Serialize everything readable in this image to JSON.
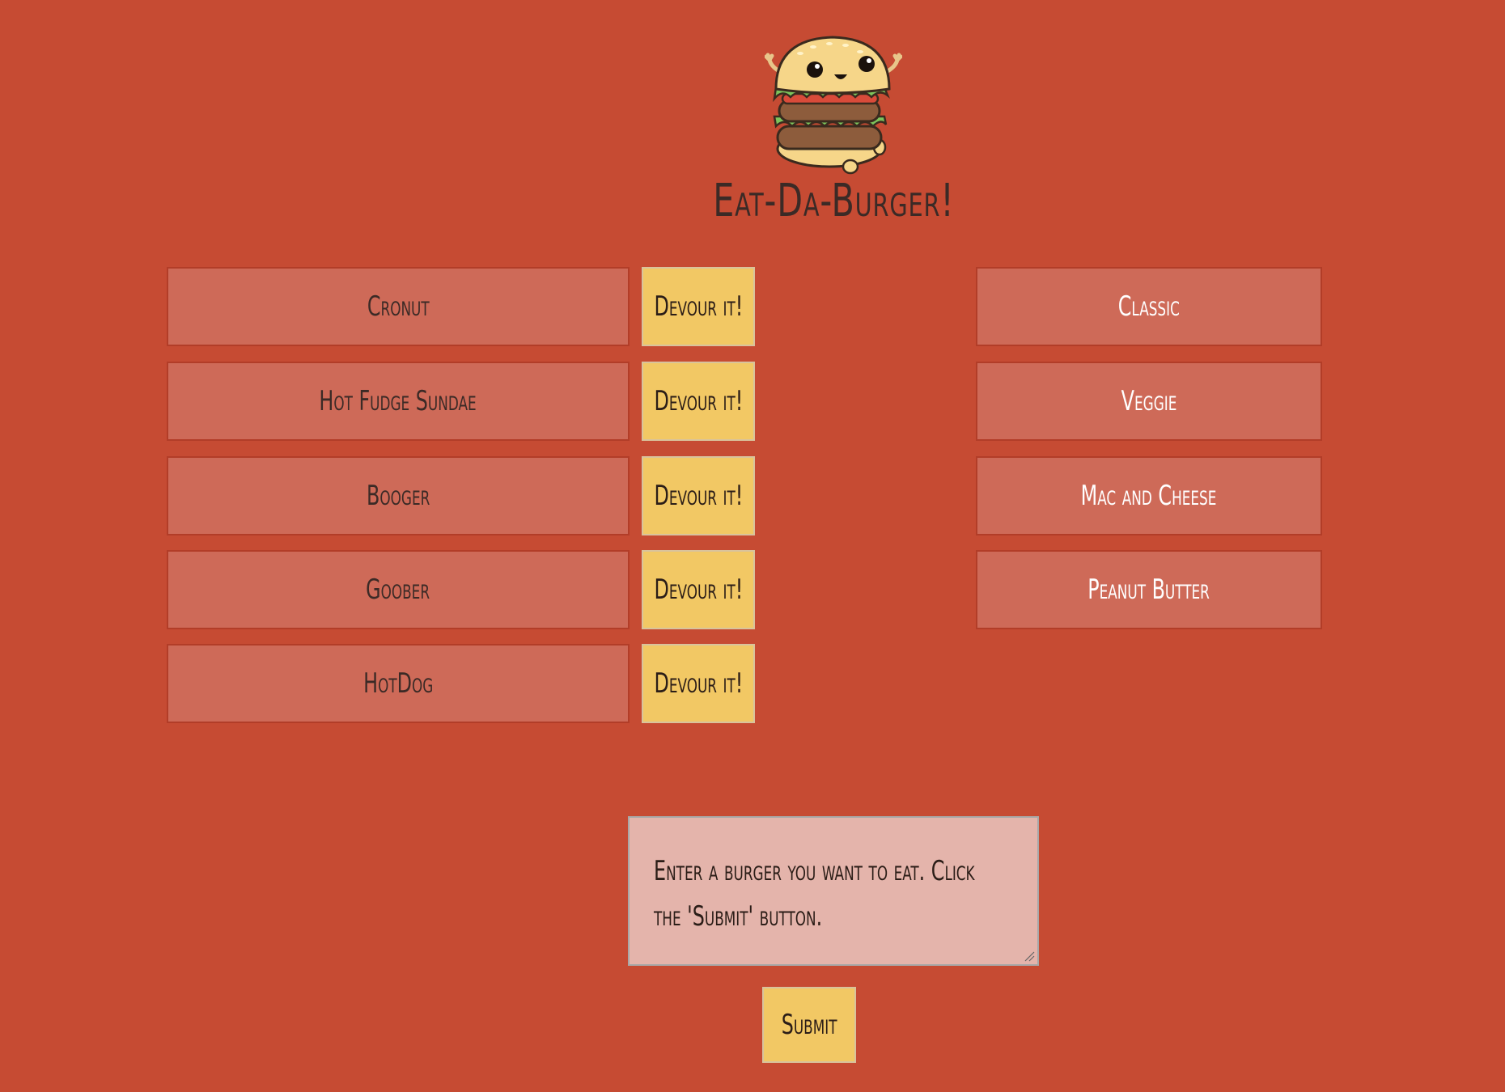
{
  "header": {
    "title": "Eat-Da-Burger!",
    "logo_icon": "burger-mascot-icon"
  },
  "uneaten_burgers": [
    {
      "name": "Cronut",
      "action_label": "Devour it!"
    },
    {
      "name": "Hot Fudge Sundae",
      "action_label": "Devour it!"
    },
    {
      "name": "Booger",
      "action_label": "Devour it!"
    },
    {
      "name": "Goober",
      "action_label": "Devour it!"
    },
    {
      "name": "HotDog",
      "action_label": "Devour it!"
    }
  ],
  "eaten_burgers": [
    {
      "name": "Classic"
    },
    {
      "name": "Veggie"
    },
    {
      "name": "Mac and Cheese"
    },
    {
      "name": "Peanut Butter"
    }
  ],
  "form": {
    "input_placeholder": "Enter a burger you want to eat. Click the 'Submit' button.",
    "submit_label": "Submit"
  },
  "colors": {
    "background": "#c64b33",
    "item_background": "#ce6a58",
    "button_yellow": "#f2c864",
    "input_background": "#e4b4ab"
  }
}
